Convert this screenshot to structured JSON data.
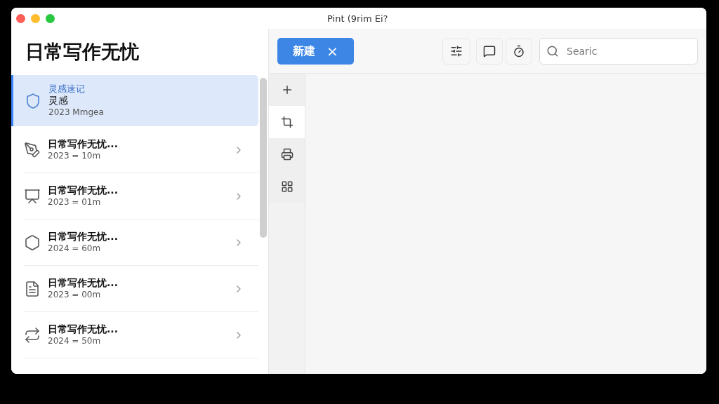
{
  "window": {
    "title": "Pint (9rim Ei?"
  },
  "sidebar": {
    "heading": "日常写作无忧",
    "items": [
      {
        "title": "灵感速记",
        "subtitle": "灵感",
        "meta": "2023 Mmgea",
        "selected": true
      },
      {
        "title": "日常写作无忧...",
        "meta": "2023 = 10m",
        "selected": false
      },
      {
        "title": "日常写作无忧...",
        "meta": "2023 = 01m",
        "selected": false
      },
      {
        "title": "日常写作无忧...",
        "meta": "2024 = 60m",
        "selected": false
      },
      {
        "title": "日常写作无忧...",
        "meta": "2023 = 00m",
        "selected": false
      },
      {
        "title": "日常写作无忧...",
        "meta": "2024 = 50m",
        "selected": false
      }
    ]
  },
  "toolbar": {
    "new_button": "新建",
    "close": "×",
    "search": {
      "placeholder": "Searic"
    }
  },
  "tools": [
    {
      "selected": false
    },
    {
      "selected": true
    },
    {
      "selected": false
    },
    {
      "selected": false
    }
  ]
}
